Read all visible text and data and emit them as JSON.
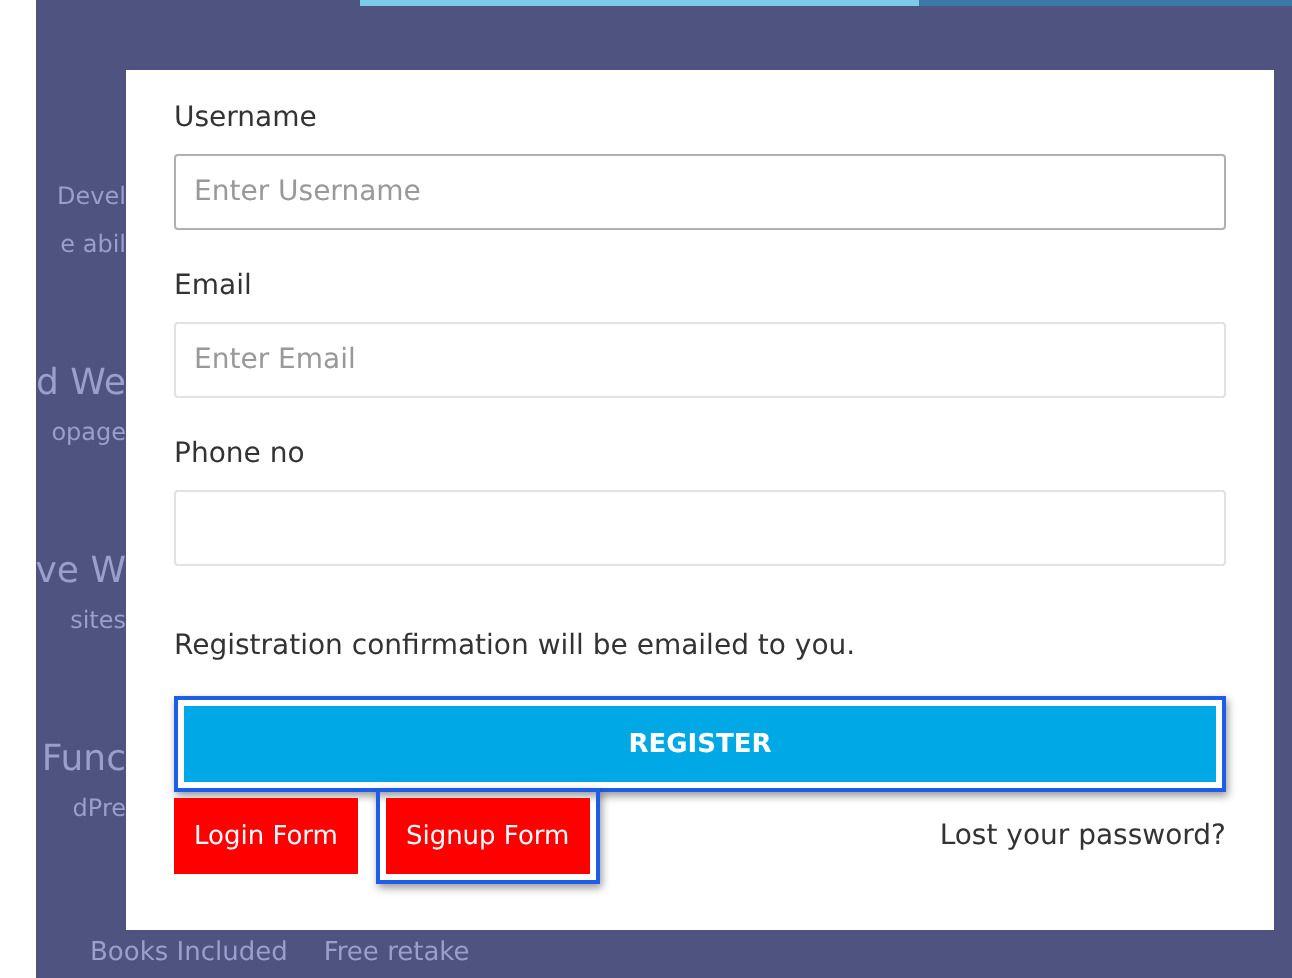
{
  "background": {
    "fragments": [
      {
        "text": "Devel",
        "kind": "body"
      },
      {
        "text": "e abil",
        "kind": "body"
      },
      {
        "text": "d We",
        "kind": "heading"
      },
      {
        "text": "opage",
        "kind": "body"
      },
      {
        "text": "ve W",
        "kind": "heading"
      },
      {
        "text": "sites",
        "kind": "body"
      },
      {
        "text": "Func",
        "kind": "heading"
      },
      {
        "text": "dPre",
        "kind": "body"
      }
    ],
    "footer": [
      "Books Included",
      "Free retake"
    ]
  },
  "form": {
    "fields": [
      {
        "label": "Username",
        "placeholder": "Enter Username",
        "focused": true
      },
      {
        "label": "Email",
        "placeholder": "Enter Email",
        "focused": false
      },
      {
        "label": "Phone no",
        "focused": false
      }
    ],
    "note": "Registration confirmation will be emailed to you.",
    "submit": {
      "label": "REGISTER",
      "highlighted": true
    },
    "links": [
      {
        "label": "Login Form",
        "highlighted": false
      },
      {
        "label": "Signup Form",
        "highlighted": true
      }
    ],
    "lost_password": "Lost your password?"
  }
}
